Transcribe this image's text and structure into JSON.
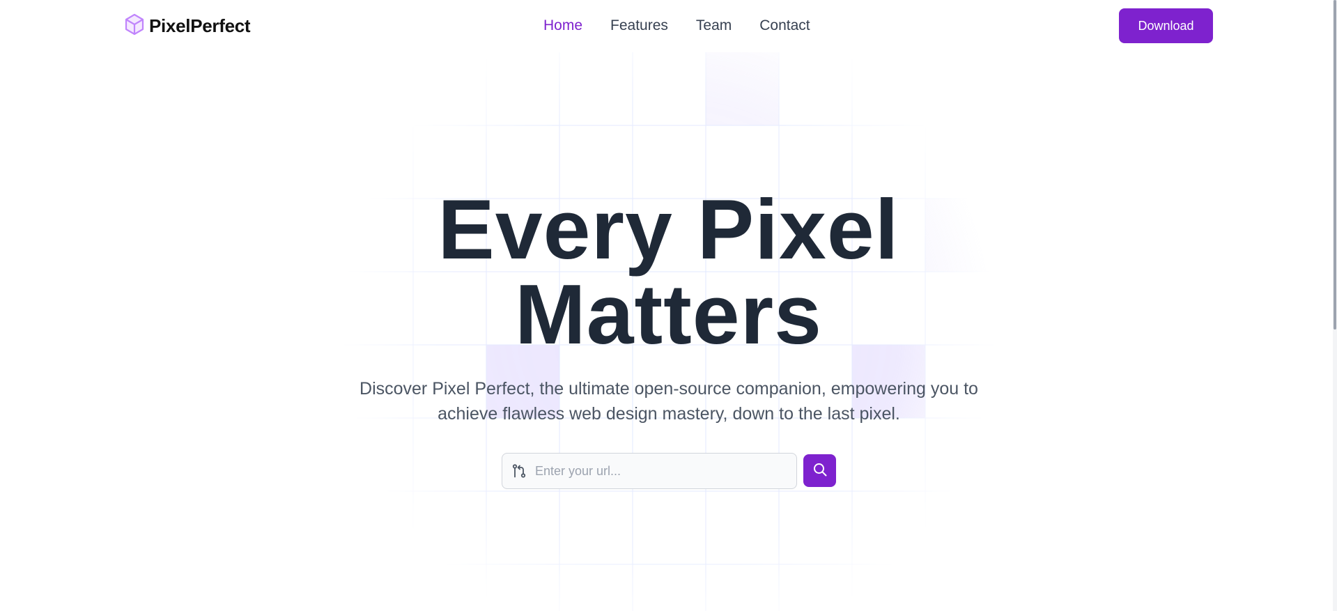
{
  "brand": {
    "name": "PixelPerfect",
    "icon": "cube-icon",
    "icon_color": "#c084fc"
  },
  "nav": {
    "items": [
      {
        "label": "Home",
        "active": true
      },
      {
        "label": "Features",
        "active": false
      },
      {
        "label": "Team",
        "active": false
      },
      {
        "label": "Contact",
        "active": false
      }
    ]
  },
  "header": {
    "download_label": "Download"
  },
  "hero": {
    "title_line1": "Every Pixel",
    "title_line2": "Matters",
    "subtitle_line1": "Discover Pixel Perfect, the ultimate open-source companion, empowering you to",
    "subtitle_line2": "achieve flawless web design mastery, down to the last pixel."
  },
  "search": {
    "placeholder": "Enter your url...",
    "value": "",
    "leading_icon": "git-compare-icon",
    "button_icon": "search-icon"
  },
  "colors": {
    "accent": "#7e22ce",
    "text_dark": "#1f2937",
    "text_muted": "#4b5563",
    "grid_tint": "#ede9fe"
  }
}
